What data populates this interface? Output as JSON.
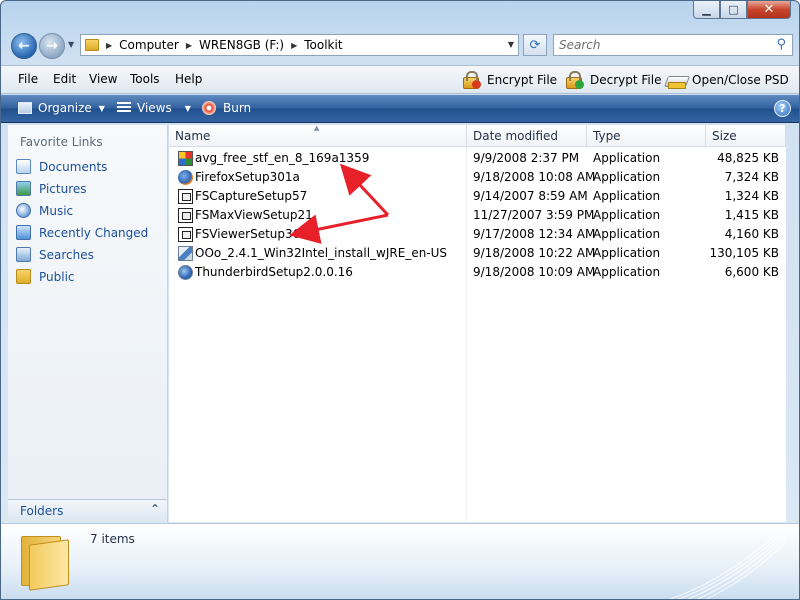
{
  "address": {
    "crumbs": [
      "Computer",
      "WREN8GB (F:)",
      "Toolkit"
    ],
    "search_placeholder": "Search"
  },
  "menu": {
    "items": [
      "File",
      "Edit",
      "View",
      "Tools",
      "Help"
    ],
    "encrypt_label": "Encrypt File",
    "decrypt_label": "Decrypt File",
    "openclose_label": "Open/Close PSD"
  },
  "toolbar": {
    "organize_label": "Organize",
    "views_label": "Views",
    "burn_label": "Burn"
  },
  "nav": {
    "favorites_header": "Favorite Links",
    "items": [
      {
        "label": "Documents",
        "icon": "documents-icon"
      },
      {
        "label": "Pictures",
        "icon": "pictures-icon"
      },
      {
        "label": "Music",
        "icon": "music-icon"
      },
      {
        "label": "Recently Changed",
        "icon": "recently-changed-icon"
      },
      {
        "label": "Searches",
        "icon": "searches-icon"
      },
      {
        "label": "Public",
        "icon": "public-folder-icon"
      }
    ],
    "folders_label": "Folders"
  },
  "columns": [
    "Name",
    "Date modified",
    "Type",
    "Size"
  ],
  "files": [
    {
      "name": "avg_free_stf_en_8_169a1359",
      "date": "9/9/2008 2:37 PM",
      "type": "Application",
      "size": "48,825 KB",
      "icon": "avg-app-icon"
    },
    {
      "name": "FirefoxSetup301a",
      "date": "9/18/2008 10:08 AM",
      "type": "Application",
      "size": "7,324 KB",
      "icon": "firefox-icon"
    },
    {
      "name": "FSCaptureSetup57",
      "date": "9/14/2007 8:59 AM",
      "type": "Application",
      "size": "1,324 KB",
      "icon": "fs-app-icon"
    },
    {
      "name": "FSMaxViewSetup21",
      "date": "11/27/2007 3:59 PM",
      "type": "Application",
      "size": "1,415 KB",
      "icon": "fs-app-icon"
    },
    {
      "name": "FSViewerSetup36",
      "date": "9/17/2008 12:34 AM",
      "type": "Application",
      "size": "4,160 KB",
      "icon": "fs-app-icon"
    },
    {
      "name": "OOo_2.4.1_Win32Intel_install_wJRE_en-US",
      "date": "9/18/2008 10:22 AM",
      "type": "Application",
      "size": "130,105 KB",
      "icon": "openoffice-icon"
    },
    {
      "name": "ThunderbirdSetup2.0.0.16",
      "date": "9/18/2008 10:09 AM",
      "type": "Application",
      "size": "6,600 KB",
      "icon": "thunderbird-icon"
    }
  ],
  "details": {
    "count_text": "7 items"
  },
  "colors": {
    "annotation_arrow": "#e8202a",
    "command_bar": "#30609e",
    "link_text": "#1b4f97"
  }
}
